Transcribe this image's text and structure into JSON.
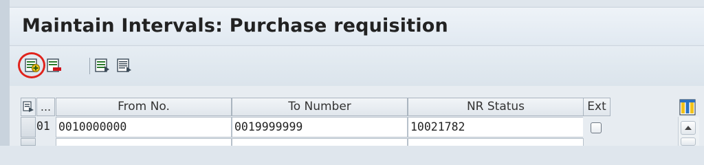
{
  "title": "Maintain Intervals: Purchase requisition",
  "toolbar": {
    "buttons": [
      {
        "name": "insert-interval-icon",
        "highlighted": true
      },
      {
        "name": "delete-interval-icon"
      },
      {
        "name": "details-icon"
      },
      {
        "name": "print-icon"
      }
    ],
    "highlight_color": "#e0231c"
  },
  "table": {
    "columns": {
      "row_no": "...",
      "from_no": "From No.",
      "to_number": "To Number",
      "nr_status": "NR Status",
      "ext": "Ext"
    },
    "rows": [
      {
        "no": "01",
        "from_no": "0010000000",
        "to_number": "0019999999",
        "nr_status": "10021782",
        "ext": false
      }
    ]
  }
}
